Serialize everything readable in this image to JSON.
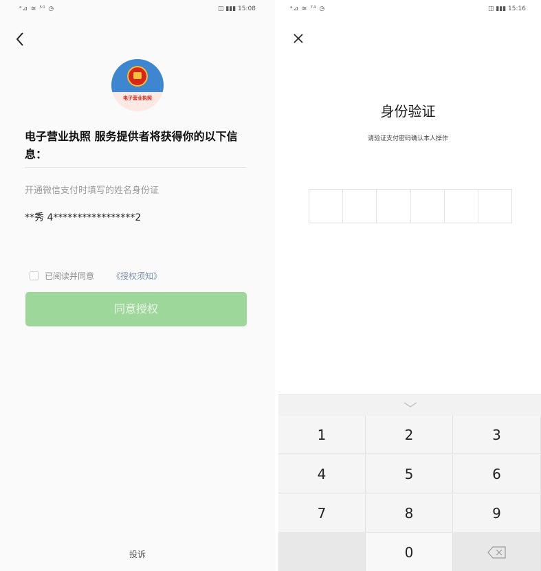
{
  "left": {
    "status_left": "ᵃ⊿ ≋ ⁵⁰ ◷",
    "status_right": "◫ ▮▮▮ 15:08",
    "logo_text": "电子营业执照",
    "heading": "电子营业执照 服务提供者将获得你的以下信息：",
    "info_label": "开通微信支付时填写的姓名身份证",
    "info_value": "**秀 4*****************2",
    "agree_text": "已阅读并同意",
    "agree_link": "《授权须知》",
    "agree_button": "同意授权",
    "complaint": "投诉",
    "button_color": "#9ed79a"
  },
  "right": {
    "status_left": "ᵃ⊿ ≋ ⁷⁴ ◷",
    "status_right": "◫ ▮▮▮ 15:16",
    "title": "身份验证",
    "subtitle": "请验证支付密码确认本人操作",
    "pin_length": 6,
    "keypad": {
      "keys": [
        "1",
        "2",
        "3",
        "4",
        "5",
        "6",
        "7",
        "8",
        "9",
        "",
        "0",
        "⌫"
      ]
    }
  }
}
